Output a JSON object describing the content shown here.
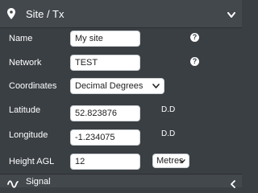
{
  "header": {
    "title": "Site / Tx",
    "icon": "map-pin-icon"
  },
  "form": {
    "name": {
      "label": "Name",
      "value": "My site"
    },
    "network": {
      "label": "Network",
      "value": "TEST"
    },
    "coordinates": {
      "label": "Coordinates",
      "selected": "Decimal Degrees"
    },
    "latitude": {
      "label": "Latitude",
      "value": "52.823876",
      "unit": "D.D"
    },
    "longitude": {
      "label": "Longitude",
      "value": "-1.234075",
      "unit": "D.D"
    },
    "height": {
      "label": "Height AGL",
      "value": "12",
      "unit": "m",
      "unit_select": "Metres"
    },
    "help_glyph": "?"
  },
  "footer": {
    "title": "Signal",
    "icon": "signal-wave-icon"
  },
  "colors": {
    "panel": "#3a3f44",
    "header": "#43484d",
    "text": "#ffffff"
  }
}
